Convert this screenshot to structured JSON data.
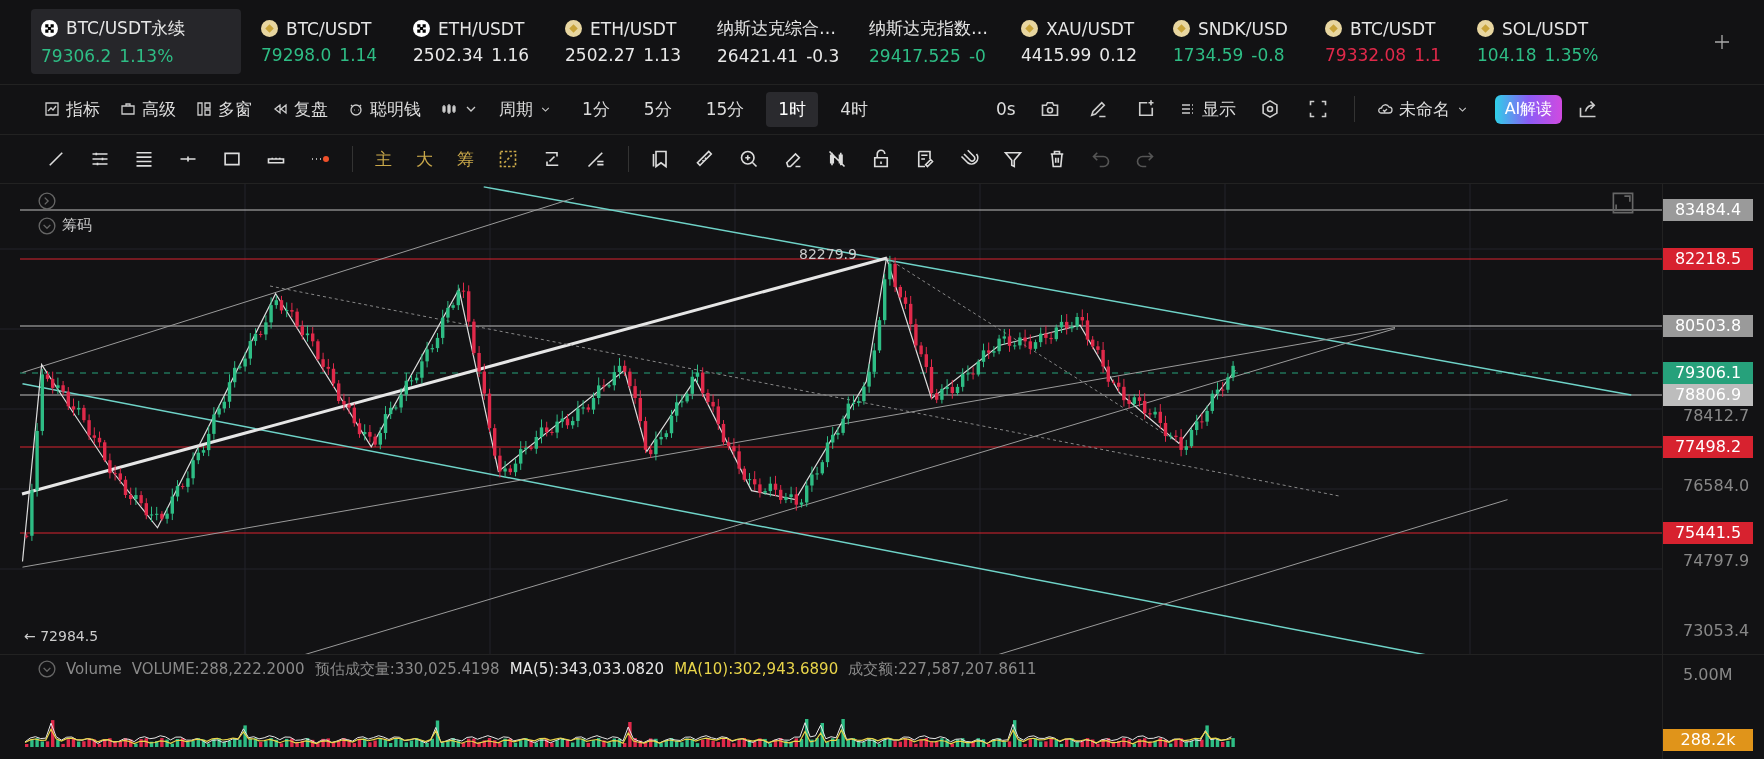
{
  "tickers": [
    {
      "name": "BTC/USDT永续",
      "price": "79306.2",
      "change": "1.13%",
      "color": "#2ebd85",
      "kind": "square",
      "selected": true
    },
    {
      "name": "BTC/USDT",
      "price": "79298.0",
      "change": "1.14",
      "color": "#2ebd85",
      "kind": "coin",
      "selected": false
    },
    {
      "name": "ETH/USDT",
      "price": "2502.34",
      "change": "1.16",
      "color": "#e8e8e8",
      "kind": "square",
      "selected": false
    },
    {
      "name": "ETH/USDT",
      "price": "2502.27",
      "change": "1.13",
      "color": "#e8e8e8",
      "kind": "coin",
      "selected": false
    },
    {
      "name": "纳斯达克综合…",
      "price": "26421.41",
      "change": "-0.3",
      "color": "#e8e8e8",
      "kind": "plain",
      "selected": false
    },
    {
      "name": "纳斯达克指数…",
      "price": "29417.525",
      "change": "-0",
      "color": "#2ebd85",
      "kind": "plain",
      "selected": false
    },
    {
      "name": "XAU/USDT",
      "price": "4415.99",
      "change": "0.12",
      "color": "#e8e8e8",
      "kind": "coin",
      "selected": false
    },
    {
      "name": "SNDK/USD",
      "price": "1734.59",
      "change": "-0.8",
      "color": "#2ebd85",
      "kind": "coin",
      "selected": false
    },
    {
      "name": "BTC/USDT",
      "price": "79332.08",
      "change": "1.1",
      "color": "#e0294a",
      "kind": "coin",
      "selected": false
    },
    {
      "name": "SOL/USDT",
      "price": "104.18",
      "change": "1.35%",
      "color": "#2ebd85",
      "kind": "coin",
      "selected": false
    }
  ],
  "toolbar": {
    "menus": [
      "指标",
      "高级",
      "多窗",
      "复盘",
      "聪明钱"
    ],
    "period_label": "周期",
    "periods": [
      {
        "label": "1分",
        "selected": false
      },
      {
        "label": "5分",
        "selected": false
      },
      {
        "label": "15分",
        "selected": false
      },
      {
        "label": "1时",
        "selected": true
      },
      {
        "label": "4时",
        "selected": false
      }
    ],
    "countdown": "0s",
    "display": "显示",
    "layout_name": "未命名",
    "ai_button": "AI解读"
  },
  "drawing_toolbar": {
    "labels": [
      "主",
      "大",
      "筹"
    ],
    "undo": {
      "disabled": true
    },
    "redo": {
      "disabled": true
    }
  },
  "chart": {
    "chip_label": "筹码",
    "high_label": "82279.9",
    "low_label": "← 72984.5"
  },
  "price_axis": {
    "levels": [
      {
        "value": "83484.4",
        "color": "#9a9a9a"
      },
      {
        "value": "82218.5",
        "color": "#d7222f"
      },
      {
        "value": "80503.8",
        "color": "#9a9a9a"
      },
      {
        "value": "79306.1",
        "color": "#26a17b"
      },
      {
        "value": "78806.9",
        "color": "#bdbdbd"
      },
      {
        "value": "77498.2",
        "color": "#d7222f"
      },
      {
        "value": "75441.5",
        "color": "#d7222f"
      }
    ],
    "ticks": [
      "78412.7",
      "76584.0",
      "74797.9",
      "73053.4"
    ]
  },
  "volume": {
    "legend": [
      {
        "text": "Volume",
        "color": "#8a8a8a"
      },
      {
        "text": "VOLUME:288,222.2000",
        "color": "#8a8a8a"
      },
      {
        "text": "预估成交量:330,025.4198",
        "color": "#8a8a8a"
      },
      {
        "text": "MA(5):343,033.0820",
        "color": "#e6e6e6"
      },
      {
        "text": "MA(10):302,943.6890",
        "color": "#e8d44a"
      },
      {
        "text": "成交额:227,587,207.8611",
        "color": "#8a8a8a"
      }
    ],
    "tick": "5.00M",
    "badge": {
      "value": "288.2k",
      "color": "#e0941a"
    }
  }
}
